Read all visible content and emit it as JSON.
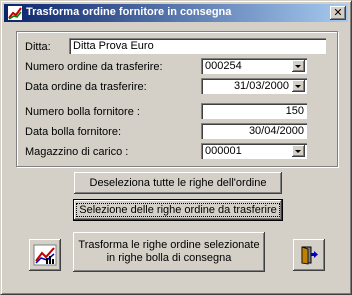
{
  "window": {
    "title": "Trasforma ordine fornitore in consegna",
    "close_label": "✕"
  },
  "form": {
    "ditta_label": "Ditta:",
    "ditta_value": "Ditta Prova Euro",
    "numero_ordine_label": "Numero ordine da trasferire:",
    "numero_ordine_value": "000254",
    "data_ordine_label": "Data ordine da trasferire:",
    "data_ordine_value": "31/03/2000",
    "numero_bolla_label": "Numero bolla fornitore :",
    "numero_bolla_value": "150",
    "data_bolla_label": "Data bolla fornitore:",
    "data_bolla_value": "30/04/2000",
    "magazzino_label": "Magazzino di carico :",
    "magazzino_value": "000001"
  },
  "buttons": {
    "deseleziona": "Deseleziona tutte le righe dell'ordine",
    "seleziona": "Selezione delle righe ordine da trasferire",
    "trasforma_line1": "Trasforma le righe ordine selezionate",
    "trasforma_line2": "in righe bolla di consegna"
  },
  "icons": {
    "title": "app-icon",
    "chart": "chart-icon",
    "exit": "exit-door-icon"
  }
}
